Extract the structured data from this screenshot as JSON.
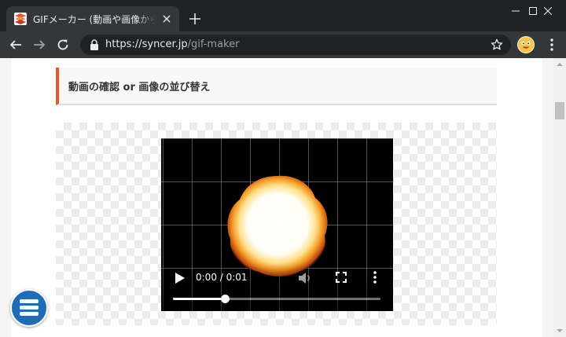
{
  "browser": {
    "tab": {
      "title": "GIFメーカー (動画や画像からアニメーションGIF作成)",
      "favicon": "syncer-favicon",
      "close_icon": "close-icon"
    },
    "new_tab_icon": "plus-icon",
    "window_controls": [
      "minimize-icon",
      "maximize-icon",
      "close-window-icon"
    ],
    "toolbar": {
      "back_icon": "arrow-left-icon",
      "forward_icon": "arrow-right-icon",
      "reload_icon": "reload-icon",
      "url_host": "https://syncer.jp",
      "url_path": "/gif-maker",
      "lock_icon": "lock-icon",
      "bookmark_icon": "star-icon",
      "profile_icon": "avatar",
      "menu_icon": "kebab-icon"
    }
  },
  "page": {
    "section_heading": "動画の確認 or 画像の並び替え",
    "accent_color": "#e05a2b",
    "video_player": {
      "time_display": "0:00 / 0:01",
      "progress": 0.25,
      "play_icon": "play-icon",
      "mute_icon": "volume-muted-icon",
      "fullscreen_icon": "fullscreen-icon",
      "more_icon": "more-vert-icon"
    },
    "menu_button": {
      "icon": "hamburger-icon",
      "color": "#1e6bb8"
    }
  }
}
